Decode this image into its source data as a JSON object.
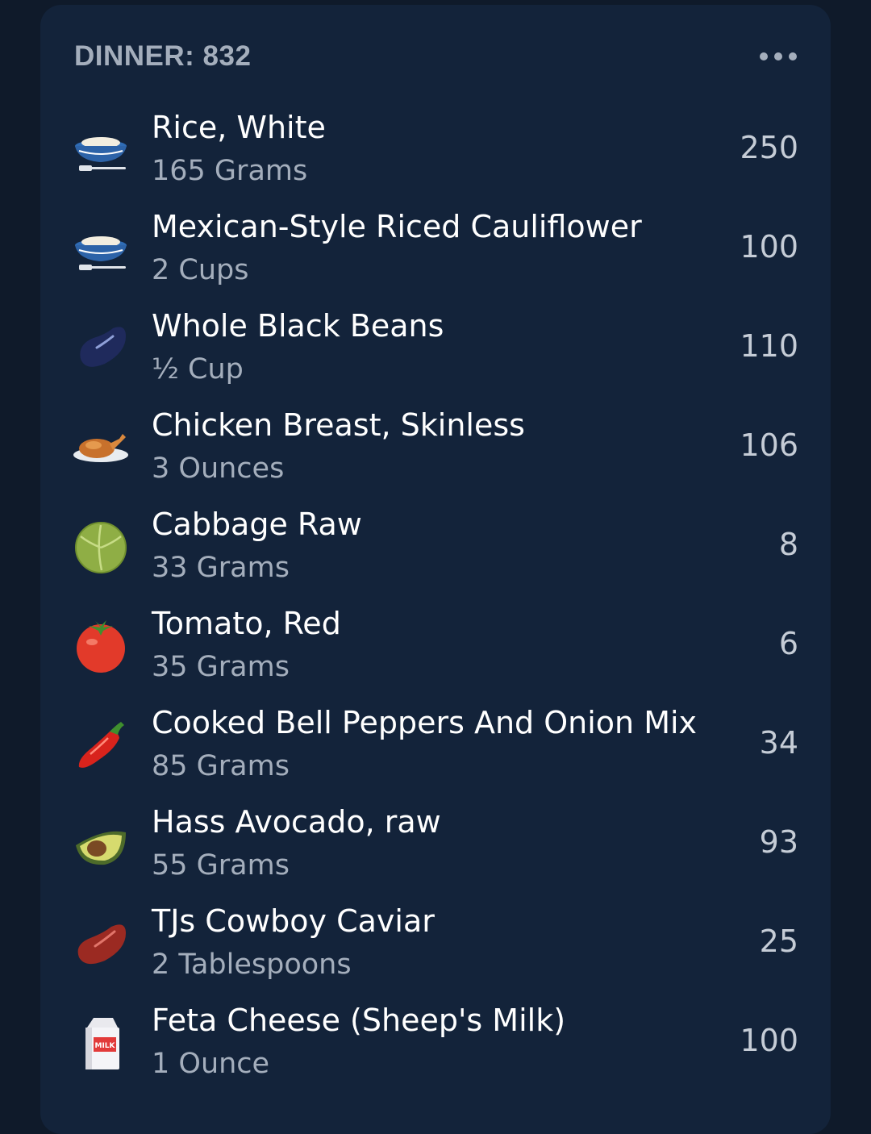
{
  "meal": {
    "title": "DINNER: 832"
  },
  "items": [
    {
      "name": "Rice, White",
      "serving": "165 Grams",
      "calories": "250",
      "icon": "rice-bowl-icon"
    },
    {
      "name": "Mexican-Style Riced Cauliflower",
      "serving": "2 Cups",
      "calories": "100",
      "icon": "rice-bowl-icon"
    },
    {
      "name": "Whole Black Beans",
      "serving": "½ Cup",
      "calories": "110",
      "icon": "black-bean-icon"
    },
    {
      "name": "Chicken Breast, Skinless",
      "serving": "3 Ounces",
      "calories": "106",
      "icon": "roast-chicken-icon"
    },
    {
      "name": "Cabbage Raw",
      "serving": "33 Grams",
      "calories": "8",
      "icon": "cabbage-icon"
    },
    {
      "name": "Tomato, Red",
      "serving": "35 Grams",
      "calories": "6",
      "icon": "tomato-icon"
    },
    {
      "name": "Cooked Bell Peppers And Onion Mix",
      "serving": "85 Grams",
      "calories": "34",
      "icon": "red-pepper-icon"
    },
    {
      "name": "Hass Avocado, raw",
      "serving": "55 Grams",
      "calories": "93",
      "icon": "avocado-icon"
    },
    {
      "name": "TJs Cowboy Caviar",
      "serving": "2 Tablespoons",
      "calories": "25",
      "icon": "red-bean-icon"
    },
    {
      "name": "Feta Cheese (Sheep's Milk)",
      "serving": "1 Ounce",
      "calories": "100",
      "icon": "milk-carton-icon",
      "icon_label": "MILK"
    }
  ]
}
